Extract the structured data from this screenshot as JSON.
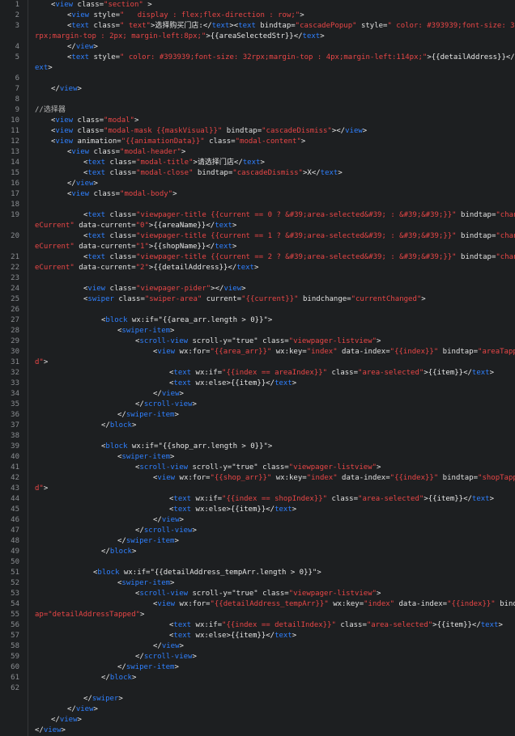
{
  "editor": {
    "theme": "dark",
    "colors": {
      "tag": "#2f80ff",
      "attr": "#e0e0e0",
      "string": "#e94646",
      "text": "#e6e6e6",
      "comment": "#b8b8b8",
      "gutter": "#8a8d91"
    }
  },
  "line_numbers": [
    "1",
    "2",
    "3",
    "4",
    "5",
    "6",
    "7",
    "8",
    "9",
    "10",
    "11",
    "12",
    "13",
    "14",
    "15",
    "16",
    "17",
    "18",
    "19",
    "20",
    "21",
    "22",
    "23",
    "24",
    "25",
    "26",
    "27",
    "28",
    "29",
    "30",
    "31",
    "32",
    "33",
    "34",
    "35",
    "36",
    "37",
    "38",
    "39",
    "40",
    "41",
    "42",
    "43",
    "44",
    "45",
    "46",
    "47",
    "48",
    "49",
    "50",
    "51",
    "52",
    "53",
    "54",
    "55",
    "56",
    "57",
    "58",
    "59",
    "60",
    "61",
    "62"
  ],
  "lines": [
    [
      [
        "x",
        "<"
      ],
      [
        "t",
        "view"
      ],
      [
        "a",
        " class="
      ],
      [
        "s",
        "\"section\""
      ],
      [
        "x",
        " >"
      ]
    ],
    [
      [
        "x",
        "<"
      ],
      [
        "t",
        "view"
      ],
      [
        "a",
        " style="
      ],
      [
        "s",
        "\"   display : flex;flex-direction : row;\""
      ],
      [
        "x",
        ">"
      ]
    ],
    [
      [
        "x",
        "<"
      ],
      [
        "t",
        "text"
      ],
      [
        "a",
        " class="
      ],
      [
        "s",
        "\" text\""
      ],
      [
        "x",
        ">选择购买门店:</"
      ],
      [
        "t",
        "text"
      ],
      [
        "x",
        "><"
      ],
      [
        "t",
        "text"
      ],
      [
        "a",
        " bindtap="
      ],
      [
        "s",
        "\"cascadePopup\""
      ],
      [
        "a",
        " style="
      ],
      [
        "s",
        "\" color: #393939;font-size: 32"
      ]
    ],
    [
      [
        "s",
        "rpx;margin-top : 2px; margin-left:8px;\""
      ],
      [
        "x",
        ">{{areaSelectedStr}}</"
      ],
      [
        "t",
        "text"
      ],
      [
        "x",
        ">"
      ]
    ],
    [
      [
        "x",
        "</"
      ],
      [
        "t",
        "view"
      ],
      [
        "x",
        ">"
      ]
    ],
    [
      [
        "x",
        "<"
      ],
      [
        "t",
        "text"
      ],
      [
        "a",
        " style="
      ],
      [
        "s",
        "\" color: #393939;font-size: 32rpx;margin-top : 4px;margin-left:114px;\""
      ],
      [
        "x",
        ">{{detailAddress}}</"
      ],
      [
        "t",
        "t"
      ]
    ],
    [
      [
        "t",
        "ext"
      ],
      [
        "x",
        ">"
      ]
    ],
    [],
    [
      [
        "x",
        "</"
      ],
      [
        "t",
        "view"
      ],
      [
        "x",
        ">"
      ]
    ],
    [],
    [
      [
        "c",
        "//选择器"
      ]
    ],
    [
      [
        "x",
        "<"
      ],
      [
        "t",
        "view"
      ],
      [
        "a",
        " class="
      ],
      [
        "s",
        "\"modal\""
      ],
      [
        "x",
        ">"
      ]
    ],
    [
      [
        "x",
        "<"
      ],
      [
        "t",
        "view"
      ],
      [
        "a",
        " class="
      ],
      [
        "s",
        "\"modal-mask {{maskVisual}}\""
      ],
      [
        "a",
        " bindtap="
      ],
      [
        "s",
        "\"cascadeDismiss\""
      ],
      [
        "x",
        "></"
      ],
      [
        "t",
        "view"
      ],
      [
        "x",
        ">"
      ]
    ],
    [
      [
        "x",
        "<"
      ],
      [
        "t",
        "view"
      ],
      [
        "a",
        " animation="
      ],
      [
        "s",
        "\"{{animationData}}\""
      ],
      [
        "a",
        " class="
      ],
      [
        "s",
        "\"modal-content\""
      ],
      [
        "x",
        ">"
      ]
    ],
    [
      [
        "x",
        "<"
      ],
      [
        "t",
        "view"
      ],
      [
        "a",
        " class="
      ],
      [
        "s",
        "\"modal-header\""
      ],
      [
        "x",
        ">"
      ]
    ],
    [
      [
        "x",
        "<"
      ],
      [
        "t",
        "text"
      ],
      [
        "a",
        " class="
      ],
      [
        "s",
        "\"modal-title\""
      ],
      [
        "x",
        ">请选择门店</"
      ],
      [
        "t",
        "text"
      ],
      [
        "x",
        ">"
      ]
    ],
    [
      [
        "x",
        "<"
      ],
      [
        "t",
        "text"
      ],
      [
        "a",
        " class="
      ],
      [
        "s",
        "\"modal-close\""
      ],
      [
        "a",
        " bindtap="
      ],
      [
        "s",
        "\"cascadeDismiss\""
      ],
      [
        "x",
        ">X</"
      ],
      [
        "t",
        "text"
      ],
      [
        "x",
        ">"
      ]
    ],
    [
      [
        "x",
        "</"
      ],
      [
        "t",
        "view"
      ],
      [
        "x",
        ">"
      ]
    ],
    [
      [
        "x",
        "<"
      ],
      [
        "t",
        "view"
      ],
      [
        "a",
        " class="
      ],
      [
        "s",
        "\"modal-body\""
      ],
      [
        "x",
        ">"
      ]
    ],
    [],
    [
      [
        "x",
        "<"
      ],
      [
        "t",
        "text"
      ],
      [
        "a",
        " class="
      ],
      [
        "s",
        "\"viewpager-title {{current == 0 ? &#39;area-selected&#39; : &#39;&#39;}}\""
      ],
      [
        "a",
        " bindtap="
      ],
      [
        "s",
        "\"chang"
      ]
    ],
    [
      [
        "s",
        "eCurrent\""
      ],
      [
        "a",
        " data-current="
      ],
      [
        "s",
        "\"0\""
      ],
      [
        "x",
        ">{{areaName}}</"
      ],
      [
        "t",
        "text"
      ],
      [
        "x",
        ">"
      ]
    ],
    [
      [
        "x",
        "<"
      ],
      [
        "t",
        "text"
      ],
      [
        "a",
        " class="
      ],
      [
        "s",
        "\"viewpager-title {{current == 1 ? &#39;area-selected&#39; : &#39;&#39;}}\""
      ],
      [
        "a",
        " bindtap="
      ],
      [
        "s",
        "\"chang"
      ]
    ],
    [
      [
        "s",
        "eCurrent\""
      ],
      [
        "a",
        " data-current="
      ],
      [
        "s",
        "\"1\""
      ],
      [
        "x",
        ">{{shopName}}</"
      ],
      [
        "t",
        "text"
      ],
      [
        "x",
        ">"
      ]
    ],
    [
      [
        "x",
        "<"
      ],
      [
        "t",
        "text"
      ],
      [
        "a",
        " class="
      ],
      [
        "s",
        "\"viewpager-title {{current == 2 ? &#39;area-selected&#39; : &#39;&#39;}}\""
      ],
      [
        "a",
        " bindtap="
      ],
      [
        "s",
        "\"chang"
      ]
    ],
    [
      [
        "s",
        "eCurrent\""
      ],
      [
        "a",
        " data-current="
      ],
      [
        "s",
        "\"2\""
      ],
      [
        "x",
        ">{{detailAddress}}</"
      ],
      [
        "t",
        "text"
      ],
      [
        "x",
        ">"
      ]
    ],
    [],
    [
      [
        "x",
        "<"
      ],
      [
        "t",
        "view"
      ],
      [
        "a",
        " class="
      ],
      [
        "s",
        "\"viewpager-pider\""
      ],
      [
        "x",
        "></"
      ],
      [
        "t",
        "view"
      ],
      [
        "x",
        ">"
      ]
    ],
    [
      [
        "x",
        "<"
      ],
      [
        "t",
        "swiper"
      ],
      [
        "a",
        " class="
      ],
      [
        "s",
        "\"swiper-area\""
      ],
      [
        "a",
        " current="
      ],
      [
        "s",
        "\"{{current}}\""
      ],
      [
        "a",
        " bindchange="
      ],
      [
        "s",
        "\"currentChanged\""
      ],
      [
        "x",
        ">"
      ]
    ],
    [],
    [
      [
        "x",
        "<"
      ],
      [
        "t",
        "block"
      ],
      [
        "a",
        " wx:if="
      ],
      [
        "x",
        "\"{{area_arr.length > 0}}\">"
      ]
    ],
    [
      [
        "x",
        "<"
      ],
      [
        "t",
        "swiper-item"
      ],
      [
        "x",
        ">"
      ]
    ],
    [
      [
        "x",
        "<"
      ],
      [
        "t",
        "scroll-view"
      ],
      [
        "a",
        " scroll-y="
      ],
      [
        "x",
        "\"true\""
      ],
      [
        "a",
        " class="
      ],
      [
        "s",
        "\"viewpager-listview\""
      ],
      [
        "x",
        ">"
      ]
    ],
    [
      [
        "x",
        "<"
      ],
      [
        "t",
        "view"
      ],
      [
        "a",
        " wx:for="
      ],
      [
        "s",
        "\"{{area_arr}}\""
      ],
      [
        "a",
        " wx:key="
      ],
      [
        "s",
        "\"index\""
      ],
      [
        "a",
        " data-index="
      ],
      [
        "s",
        "\"{{index}}\""
      ],
      [
        "a",
        " bindtap="
      ],
      [
        "s",
        "\"areaTappe"
      ]
    ],
    [
      [
        "s",
        "d\""
      ],
      [
        "x",
        ">"
      ]
    ],
    [
      [
        "x",
        "<"
      ],
      [
        "t",
        "text"
      ],
      [
        "a",
        " wx:if="
      ],
      [
        "s",
        "\"{{index == areaIndex}}\""
      ],
      [
        "a",
        " class="
      ],
      [
        "s",
        "\"area-selected\""
      ],
      [
        "x",
        ">{{item}}</"
      ],
      [
        "t",
        "text"
      ],
      [
        "x",
        ">"
      ]
    ],
    [
      [
        "x",
        "<"
      ],
      [
        "t",
        "text"
      ],
      [
        "a",
        " wx:else"
      ],
      [
        "x",
        ">{{item}}</"
      ],
      [
        "t",
        "text"
      ],
      [
        "x",
        ">"
      ]
    ],
    [
      [
        "x",
        "</"
      ],
      [
        "t",
        "view"
      ],
      [
        "x",
        ">"
      ]
    ],
    [
      [
        "x",
        "</"
      ],
      [
        "t",
        "scroll-view"
      ],
      [
        "x",
        ">"
      ]
    ],
    [
      [
        "x",
        "</"
      ],
      [
        "t",
        "swiper-item"
      ],
      [
        "x",
        ">"
      ]
    ],
    [
      [
        "x",
        "</"
      ],
      [
        "t",
        "block"
      ],
      [
        "x",
        ">"
      ]
    ],
    [],
    [
      [
        "x",
        "<"
      ],
      [
        "t",
        "block"
      ],
      [
        "a",
        " wx:if="
      ],
      [
        "x",
        "\"{{shop_arr.length > 0}}\">"
      ]
    ],
    [
      [
        "x",
        "<"
      ],
      [
        "t",
        "swiper-item"
      ],
      [
        "x",
        ">"
      ]
    ],
    [
      [
        "x",
        "<"
      ],
      [
        "t",
        "scroll-view"
      ],
      [
        "a",
        " scroll-y="
      ],
      [
        "x",
        "\"true\""
      ],
      [
        "a",
        " class="
      ],
      [
        "s",
        "\"viewpager-listview\""
      ],
      [
        "x",
        ">"
      ]
    ],
    [
      [
        "x",
        "<"
      ],
      [
        "t",
        "view"
      ],
      [
        "a",
        " wx:for="
      ],
      [
        "s",
        "\"{{shop_arr}}\""
      ],
      [
        "a",
        " wx:key="
      ],
      [
        "s",
        "\"index\""
      ],
      [
        "a",
        " data-index="
      ],
      [
        "s",
        "\"{{index}}\""
      ],
      [
        "a",
        " bindtap="
      ],
      [
        "s",
        "\"shopTappe"
      ]
    ],
    [
      [
        "s",
        "d\""
      ],
      [
        "x",
        ">"
      ]
    ],
    [
      [
        "x",
        "<"
      ],
      [
        "t",
        "text"
      ],
      [
        "a",
        " wx:if="
      ],
      [
        "s",
        "\"{{index == shopIndex}}\""
      ],
      [
        "a",
        " class="
      ],
      [
        "s",
        "\"area-selected\""
      ],
      [
        "x",
        ">{{item}}</"
      ],
      [
        "t",
        "text"
      ],
      [
        "x",
        ">"
      ]
    ],
    [
      [
        "x",
        "<"
      ],
      [
        "t",
        "text"
      ],
      [
        "a",
        " wx:else"
      ],
      [
        "x",
        ">{{item}}</"
      ],
      [
        "t",
        "text"
      ],
      [
        "x",
        ">"
      ]
    ],
    [
      [
        "x",
        "</"
      ],
      [
        "t",
        "view"
      ],
      [
        "x",
        ">"
      ]
    ],
    [
      [
        "x",
        "</"
      ],
      [
        "t",
        "scroll-view"
      ],
      [
        "x",
        ">"
      ]
    ],
    [
      [
        "x",
        "</"
      ],
      [
        "t",
        "swiper-item"
      ],
      [
        "x",
        ">"
      ]
    ],
    [
      [
        "x",
        "</"
      ],
      [
        "t",
        "block"
      ],
      [
        "x",
        ">"
      ]
    ],
    [],
    [
      [
        "x",
        "<"
      ],
      [
        "t",
        "block"
      ],
      [
        "a",
        " wx:if="
      ],
      [
        "x",
        "\"{{detailAddress_tempArr.length > 0}}\">"
      ]
    ],
    [
      [
        "x",
        "<"
      ],
      [
        "t",
        "swiper-item"
      ],
      [
        "x",
        ">"
      ]
    ],
    [
      [
        "x",
        "<"
      ],
      [
        "t",
        "scroll-view"
      ],
      [
        "a",
        " scroll-y="
      ],
      [
        "x",
        "\"true\""
      ],
      [
        "a",
        " class="
      ],
      [
        "s",
        "\"viewpager-listview\""
      ],
      [
        "x",
        ">"
      ]
    ],
    [
      [
        "x",
        "<"
      ],
      [
        "t",
        "view"
      ],
      [
        "a",
        " wx:for="
      ],
      [
        "s",
        "\"{{detailAddress_tempArr}}\""
      ],
      [
        "a",
        " wx:key="
      ],
      [
        "s",
        "\"index\""
      ],
      [
        "a",
        " data-index="
      ],
      [
        "s",
        "\"{{index}}\""
      ],
      [
        "a",
        " bindt"
      ]
    ],
    [
      [
        "s",
        "ap=\"detailAddressTapped\""
      ],
      [
        "x",
        ">"
      ]
    ],
    [
      [
        "x",
        "<"
      ],
      [
        "t",
        "text"
      ],
      [
        "a",
        " wx:if="
      ],
      [
        "s",
        "\"{{index == detailIndex}}\""
      ],
      [
        "a",
        " class="
      ],
      [
        "s",
        "\"area-selected\""
      ],
      [
        "x",
        ">{{item}}</"
      ],
      [
        "t",
        "text"
      ],
      [
        "x",
        ">"
      ]
    ],
    [
      [
        "x",
        "<"
      ],
      [
        "t",
        "text"
      ],
      [
        "a",
        " wx:else"
      ],
      [
        "x",
        ">{{item}}</"
      ],
      [
        "t",
        "text"
      ],
      [
        "x",
        ">"
      ]
    ],
    [
      [
        "x",
        "</"
      ],
      [
        "t",
        "view"
      ],
      [
        "x",
        ">"
      ]
    ],
    [
      [
        "x",
        "</"
      ],
      [
        "t",
        "scroll-view"
      ],
      [
        "x",
        ">"
      ]
    ],
    [
      [
        "x",
        "</"
      ],
      [
        "t",
        "swiper-item"
      ],
      [
        "x",
        ">"
      ]
    ],
    [
      [
        "x",
        "</"
      ],
      [
        "t",
        "block"
      ],
      [
        "x",
        ">"
      ]
    ],
    [],
    [
      [
        "x",
        "</"
      ],
      [
        "t",
        "swiper"
      ],
      [
        "x",
        ">"
      ]
    ],
    [
      [
        "x",
        "</"
      ],
      [
        "t",
        "view"
      ],
      [
        "x",
        ">"
      ]
    ],
    [
      [
        "x",
        "</"
      ],
      [
        "t",
        "view"
      ],
      [
        "x",
        ">"
      ]
    ],
    [
      [
        "x",
        "</"
      ],
      [
        "t",
        "view"
      ],
      [
        "x",
        ">"
      ]
    ]
  ]
}
